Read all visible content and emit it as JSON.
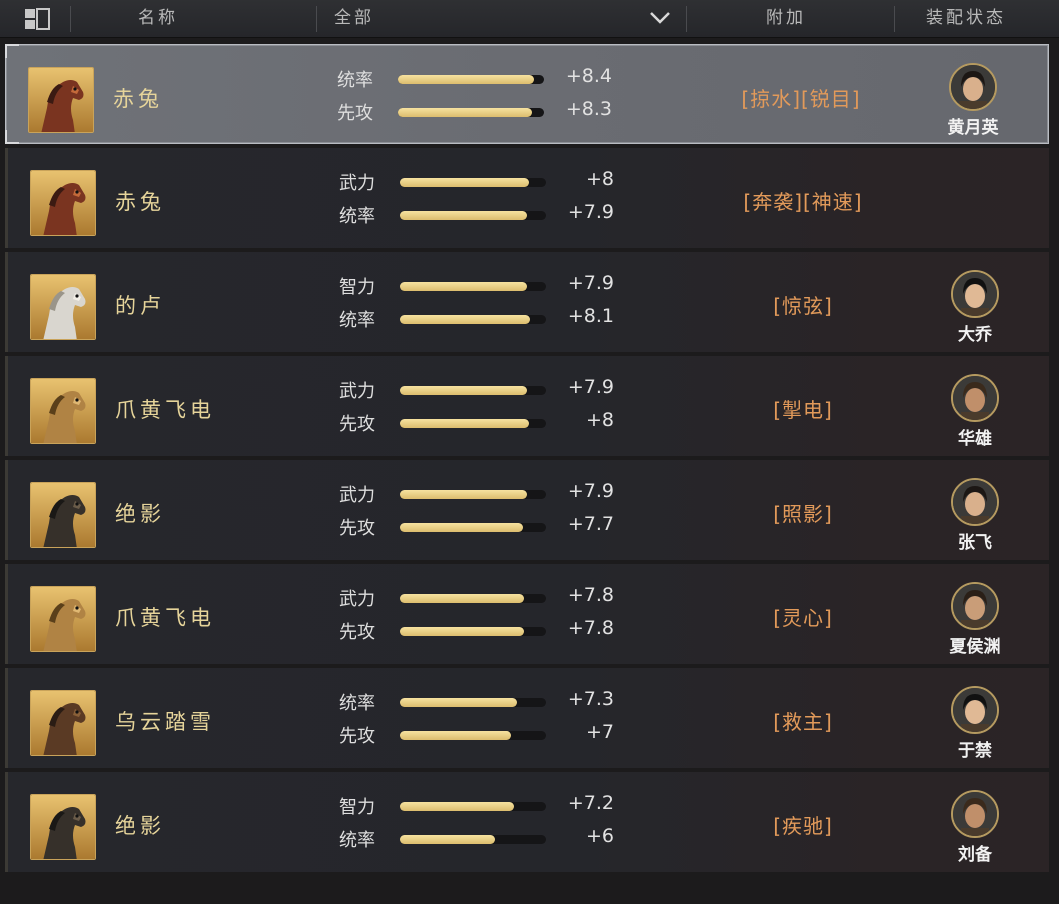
{
  "header": {
    "col_name": "名称",
    "col_filter": "全部",
    "col_extra": "附加",
    "col_status": "装配状态"
  },
  "rows": [
    {
      "name": "赤兔",
      "coat": "red",
      "stats": [
        {
          "label": "统率",
          "value": "+8.4",
          "fill": 0.93
        },
        {
          "label": "先攻",
          "value": "+8.3",
          "fill": 0.92
        }
      ],
      "extra": "[掠水][锐目]",
      "general": "黄月英",
      "selected": true
    },
    {
      "name": "赤兔",
      "coat": "red",
      "stats": [
        {
          "label": "武力",
          "value": "+8",
          "fill": 0.88
        },
        {
          "label": "统率",
          "value": "+7.9",
          "fill": 0.87
        }
      ],
      "extra": "[奔袭][神速]",
      "general": ""
    },
    {
      "name": "的卢",
      "coat": "white",
      "stats": [
        {
          "label": "智力",
          "value": "+7.9",
          "fill": 0.87
        },
        {
          "label": "统率",
          "value": "+8.1",
          "fill": 0.89
        }
      ],
      "extra": "[惊弦]",
      "general": "大乔"
    },
    {
      "name": "爪黄飞电",
      "coat": "gold",
      "stats": [
        {
          "label": "武力",
          "value": "+7.9",
          "fill": 0.87
        },
        {
          "label": "先攻",
          "value": "+8",
          "fill": 0.88
        }
      ],
      "extra": "[掣电]",
      "general": "华雄"
    },
    {
      "name": "绝影",
      "coat": "black",
      "stats": [
        {
          "label": "武力",
          "value": "+7.9",
          "fill": 0.87
        },
        {
          "label": "先攻",
          "value": "+7.7",
          "fill": 0.84
        }
      ],
      "extra": "[照影]",
      "general": "张飞"
    },
    {
      "name": "爪黄飞电",
      "coat": "gold",
      "stats": [
        {
          "label": "武力",
          "value": "+7.8",
          "fill": 0.85
        },
        {
          "label": "先攻",
          "value": "+7.8",
          "fill": 0.85
        }
      ],
      "extra": "[灵心]",
      "general": "夏侯渊"
    },
    {
      "name": "乌云踏雪",
      "coat": "dark",
      "stats": [
        {
          "label": "统率",
          "value": "+7.3",
          "fill": 0.8
        },
        {
          "label": "先攻",
          "value": "+7",
          "fill": 0.76
        }
      ],
      "extra": "[救主]",
      "general": "于禁"
    },
    {
      "name": "绝影",
      "coat": "black",
      "stats": [
        {
          "label": "智力",
          "value": "+7.2",
          "fill": 0.78
        },
        {
          "label": "统率",
          "value": "+6",
          "fill": 0.65
        }
      ],
      "extra": "[疾驰]",
      "general": "刘备"
    }
  ],
  "colors": {
    "accent_gold": "#e6d49a",
    "skill_orange": "#e29a5a",
    "bar_gold": "#f0d78c"
  }
}
